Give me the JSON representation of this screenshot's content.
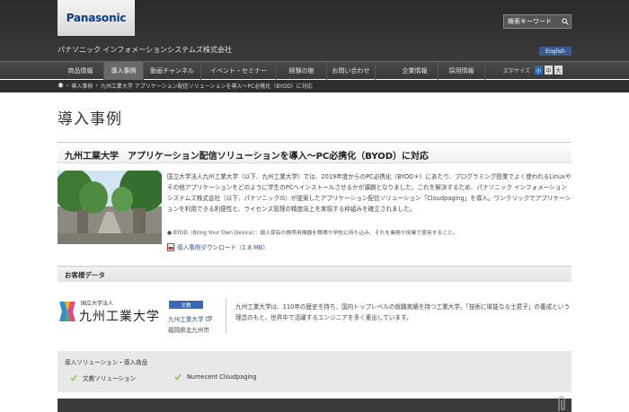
{
  "header": {
    "logo": "Panasonic",
    "search_label": "検索キーワード",
    "company": "パナソニック インフォメーションシステムズ株式会社",
    "english": "English"
  },
  "nav": {
    "items": [
      "商品情報",
      "導入事例",
      "動画チャンネル",
      "イベント・セミナー",
      "経験の樹",
      "お問い合わせ",
      "企業情報",
      "採用情報"
    ],
    "active": "導入事例",
    "fontsize_label": "文字サイズ",
    "fontsize_options": [
      "小",
      "中",
      "大"
    ]
  },
  "breadcrumb": {
    "items": [
      "導入事例",
      "九州工業大学 アプリケーション配信ソリューションを導入〜PC必携化（BYOD）に対応"
    ]
  },
  "page_title": "導入事例",
  "headline": "九州工業大学　アプリケーション配信ソリューションを導入〜PC必携化（BYOD）に対応",
  "body": {
    "text": "国立大学法人九州工業大学（以下、九州工業大学）では、2019年度からのPC必携化（BYOD＊）にあたり、プログラミング授業でよく使われるLinuxやその他アプリケーションをどのように学生のPCへインストールさせるかが課題となりました。これを解決するため、パナソニック インフォメーションシステムズ株式会社（以下、パナソニックIS）が提案したアプリケーション配信ソリューション「Cloudpaging」を導入。ワンクリックでアプリケーションを利用できる利便性と、ライセンス管理の精度向上を実現する枠組みを確立されました。",
    "byod_note": "● BYOD（Bring Your Own Device）：個人保有の携帯用機器を職場や学校に持ち込み、それを業務や授業で使用すること。",
    "pdf_link": "導入事例ダウンロード（1.8 MB）"
  },
  "customer": {
    "section_title": "お客様データ",
    "logo_small": "国立大学法人",
    "logo_big": "九州工業大学",
    "tag": "文教",
    "link": "九州工業大学",
    "address": "福岡県北九州市",
    "description": "九州工業大学は、110年の歴史を持ち、国内トップレベルの就職実績を持つ工業大学。「技術に堪能なる士君子」の養成という理念のもと、世界中で活躍するエンジニアを多く輩出しています。"
  },
  "solutions": {
    "title": "導入ソリューション・導入商品",
    "items": [
      "文教ソリューション",
      "Numecent Cloudpaging"
    ]
  },
  "colors": {
    "header_bg": "#2a2a2a",
    "link": "#2a56a8",
    "tag_bg": "#3a68b6",
    "check": "#8cc63f"
  }
}
